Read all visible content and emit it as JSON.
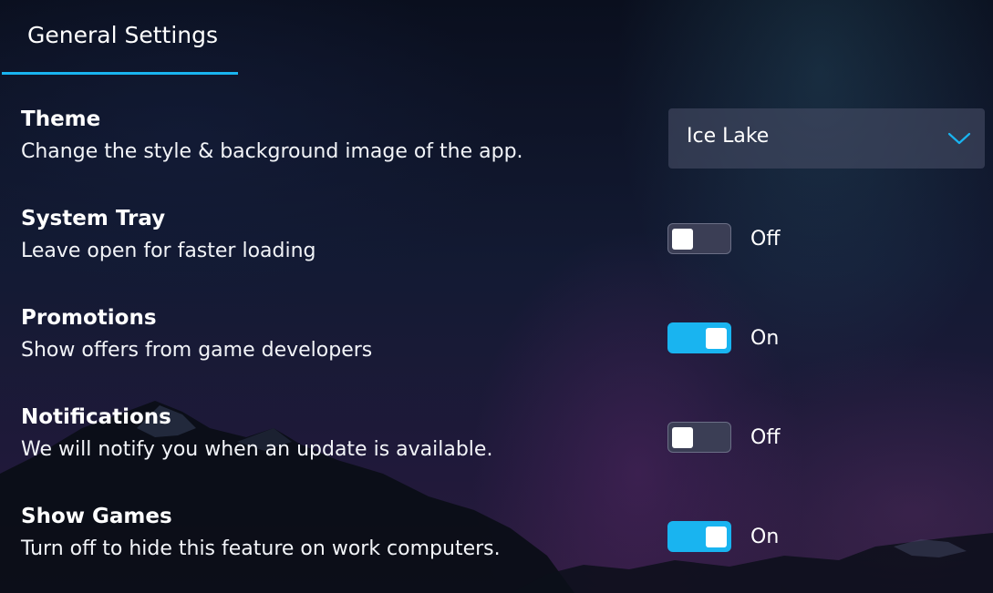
{
  "tabs": [
    {
      "label": "General Settings",
      "active": true
    }
  ],
  "settings": {
    "theme": {
      "title": "Theme",
      "description": "Change the style & background image of the app.",
      "value": "Ice Lake",
      "icon": "chevron-down-icon"
    },
    "system_tray": {
      "title": "System Tray",
      "description": "Leave open for faster loading",
      "enabled": false,
      "state_label": "Off"
    },
    "promotions": {
      "title": "Promotions",
      "description": "Show offers from game developers",
      "enabled": true,
      "state_label": "On"
    },
    "notifications": {
      "title": "Notifications",
      "description": "We will notify you when an update is available.",
      "enabled": false,
      "state_label": "Off"
    },
    "show_games": {
      "title": "Show Games",
      "description": "Turn off to hide this feature on work computers.",
      "enabled": true,
      "state_label": "On"
    }
  },
  "colors": {
    "accent": "#19b4f0",
    "toggle_off_bg": "#3b3e55",
    "dropdown_bg": "#464c64",
    "text": "#ffffff"
  }
}
